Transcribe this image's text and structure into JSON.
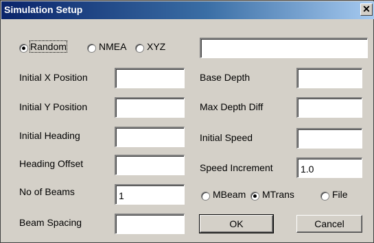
{
  "window": {
    "title": "Simulation Setup",
    "close_glyph": "✕"
  },
  "mode": {
    "options": [
      {
        "label": "Random",
        "selected": true
      },
      {
        "label": "NMEA",
        "selected": false
      },
      {
        "label": "XYZ",
        "selected": false
      }
    ],
    "file_value": ""
  },
  "left_fields": [
    {
      "label": "Initial X Position",
      "value": ""
    },
    {
      "label": "Initial Y Position",
      "value": ""
    },
    {
      "label": "Initial Heading",
      "value": ""
    },
    {
      "label": "Heading Offset",
      "value": ""
    },
    {
      "label": "No of Beams",
      "value": "1"
    },
    {
      "label": "Beam Spacing",
      "value": ""
    }
  ],
  "right_fields": [
    {
      "label": "Base Depth",
      "value": ""
    },
    {
      "label": "Max Depth Diff",
      "value": ""
    },
    {
      "label": "Initial Speed",
      "value": ""
    },
    {
      "label": "Speed Increment",
      "value": "1.0"
    }
  ],
  "output": {
    "options": [
      {
        "label": "MBeam",
        "selected": false
      },
      {
        "label": "MTrans",
        "selected": true
      },
      {
        "label": "File",
        "selected": false
      }
    ]
  },
  "buttons": {
    "ok": "OK",
    "cancel": "Cancel"
  }
}
